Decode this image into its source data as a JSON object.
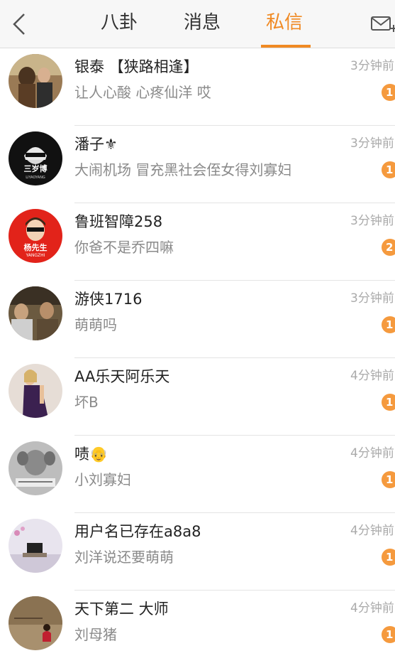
{
  "header": {
    "tabs": [
      "八卦",
      "消息",
      "私信"
    ],
    "active_tab": 2,
    "accent_color": "#f08a24",
    "back_icon": "chevron-left-icon",
    "compose_icon": "envelope-plus-icon"
  },
  "messages": [
    {
      "name": "银泰 【狭路相逢】",
      "preview": "让人心酸 心疼仙洋 哎",
      "time": "3分钟前",
      "unread": "1",
      "avatar_text": ""
    },
    {
      "name": "潘子⚜",
      "preview": "大闹机场 冒充黑社会侄女得刘寡妇",
      "time": "3分钟前",
      "unread": "1",
      "avatar_text": "三岁博",
      "avatar_subtext": "LIYAOYANG"
    },
    {
      "name": "鲁班智障258",
      "preview": "你爸不是乔四嘛",
      "time": "3分钟前",
      "unread": "2",
      "avatar_text": "杨先生",
      "avatar_subtext": "YANGZHI"
    },
    {
      "name": "游侠1716",
      "preview": "萌萌吗",
      "time": "3分钟前",
      "unread": "1",
      "avatar_text": ""
    },
    {
      "name": "AA乐天阿乐天",
      "preview": "坏B",
      "time": "4分钟前",
      "unread": "1",
      "avatar_text": ""
    },
    {
      "name": "啧👴",
      "preview": "小刘寡妇",
      "time": "4分钟前",
      "unread": "1",
      "avatar_text": ""
    },
    {
      "name": "用户名已存在a8a8",
      "preview": "刘洋说还要萌萌",
      "time": "4分钟前",
      "unread": "1",
      "avatar_text": ""
    },
    {
      "name": "天下第二 大师",
      "preview": "刘母猪",
      "time": "4分钟前",
      "unread": "1",
      "avatar_text": ""
    }
  ]
}
